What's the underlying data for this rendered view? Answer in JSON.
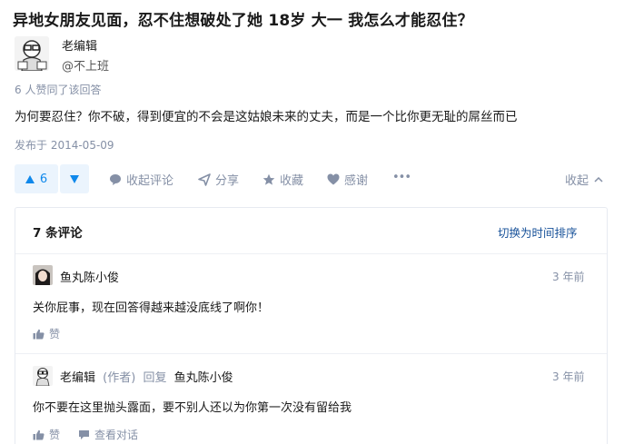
{
  "question": {
    "title": "异地女朋友见面，忍不住想破处了她 18岁 大一 我怎么才能忍住？"
  },
  "author": {
    "name": "老编辑",
    "bio": "@不上班"
  },
  "answer": {
    "votes_text": "6 人赞同了该回答",
    "content": "为何要忍住？你不破，得到便宜的不会是这姑娘未来的丈夫，而是一个比你更无耻的屌丝而已",
    "published": "发布于 2014-05-09"
  },
  "actions": {
    "upvote_count": "6",
    "comments": "收起评论",
    "share": "分享",
    "collect": "收藏",
    "thanks": "感谢",
    "more": "•••",
    "collapse": "收起"
  },
  "comments_section": {
    "header": "7 条评论",
    "sort_toggle": "切换为时间排序",
    "items": [
      {
        "author": "鱼丸陈小俊",
        "time": "3 年前",
        "text": "关你屁事，现在回答得越来越没底线了啊你！",
        "like_label": "赞"
      },
      {
        "author": "老编辑",
        "author_tag": "(作者)",
        "reply_word": "回复",
        "reply_to": "鱼丸陈小俊",
        "time": "3 年前",
        "text": "你不要在这里抛头露面，要不别人还以为你第一次没有留给我",
        "like_label": "赞",
        "view_conversation": "查看对话"
      }
    ]
  },
  "colors": {
    "accent_blue": "#0f88eb",
    "link_blue": "#175199",
    "muted_gray": "#8590a6"
  }
}
